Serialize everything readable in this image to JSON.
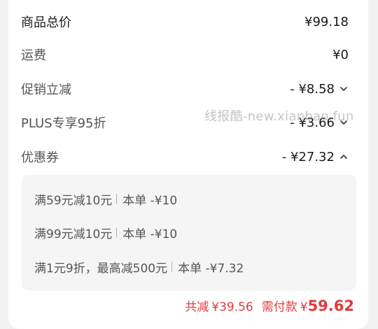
{
  "rows": [
    {
      "label": "商品总价",
      "value": "¥99.18"
    },
    {
      "label": "运费",
      "value": "¥0"
    },
    {
      "label": "促销立减",
      "value": "- ¥8.58",
      "chevron": "chevron-down-icon"
    },
    {
      "label": "PLUS专享95折",
      "value": "- ¥3.66",
      "chevron": "chevron-down-icon"
    },
    {
      "label": "优惠券",
      "value": "- ¥27.32",
      "chevron": "chevron-up-icon"
    }
  ],
  "watermark": "线报酷-new.xianbao.fun",
  "coupons": [
    {
      "desc": "满59元减10元",
      "amount": "本单 -¥10"
    },
    {
      "desc": "满99元减10元",
      "amount": "本单 -¥10"
    },
    {
      "desc": "满1元9折，最高减500元",
      "amount": "本单 -¥7.32"
    }
  ],
  "summary": {
    "reduce_label": "共减",
    "reduce_amount": "¥39.56",
    "pay_label": "需付款",
    "pay_currency": "¥",
    "pay_amount": "59.62"
  },
  "colors": {
    "accent": "#e4393c",
    "background": "#f2f2f2",
    "card": "#ffffff",
    "coupon_box": "#f5f5f5"
  }
}
